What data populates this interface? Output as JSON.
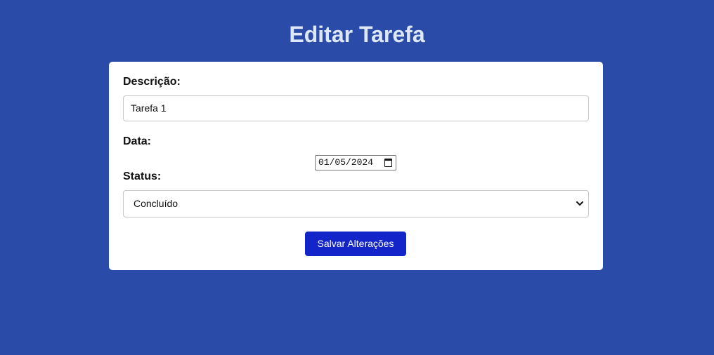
{
  "page": {
    "title": "Editar Tarefa"
  },
  "form": {
    "description_label": "Descrição:",
    "description_value": "Tarefa 1",
    "date_label": "Data:",
    "date_value": "01/05/2024",
    "status_label": "Status:",
    "status_value": "Concluído",
    "save_label": "Salvar Alterações"
  },
  "icons": {
    "date_picker": "calendar-icon",
    "select_arrow": "chevron-down-icon"
  },
  "colors": {
    "background": "#2a4ba8",
    "title_text": "#dde7f7",
    "card": "#ffffff",
    "button": "#1324c9",
    "button_text": "#ffffff"
  }
}
